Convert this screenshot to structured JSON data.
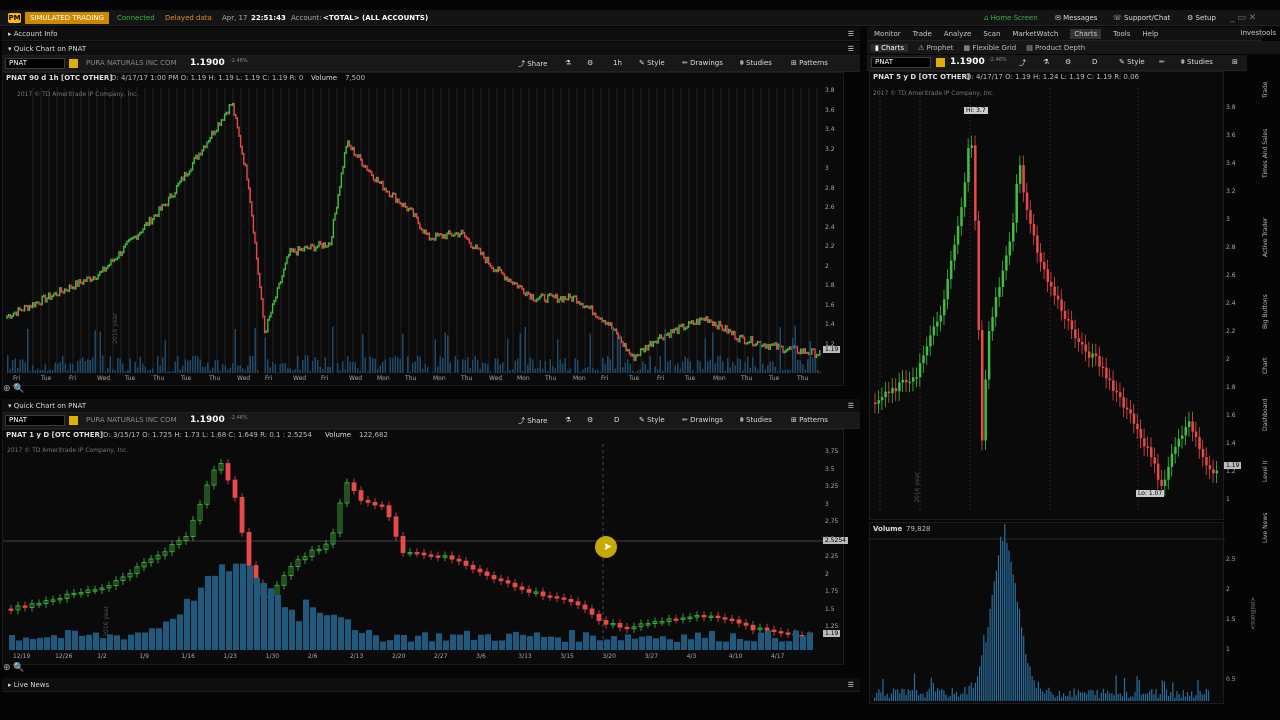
{
  "top": {
    "pm": "PM",
    "mode": "SIMULATED TRADING",
    "connected": "Connected",
    "delayed": "Delayed data",
    "date": "Apr, 17",
    "time": "22:51:43",
    "account": "Account:",
    "account_val": "<TOTAL> (ALL ACCOUNTS)",
    "home": "Home Screen",
    "messages": "Messages",
    "support": "Support/Chat",
    "setup": "Setup"
  },
  "left": {
    "account_info": "Account Info",
    "q1": {
      "title": "Quick Chart on PNAT",
      "symbol": "PNAT",
      "company": "PURA NATURALS INC COM",
      "price": "1.1900",
      "chg": "-2.46%",
      "period": "1h",
      "style": "Style",
      "drawings": "Drawings",
      "studies": "Studies",
      "patterns": "Patterns",
      "share": "Share",
      "info": "PNAT 90 d 1h [OTC OTHER]",
      "ohlc": "D: 4/17/17 1:00 PM   O: 1.19   H: 1.19   L: 1.19   C: 1.19   R: 0",
      "volume": "Volume",
      "vol_val": "7,500",
      "copyright": "2017 © TD Ameritrade IP Company, Inc.",
      "last": "1.19",
      "xlabels": [
        "Fri",
        "Tue",
        "Fri",
        "Wed",
        "Tue",
        "Thu",
        "Tue",
        "Thu",
        "Wed",
        "Fri",
        "Wed",
        "Fri",
        "Wed",
        "Mon",
        "Thu",
        "Mon",
        "Thu",
        "Wed",
        "Mon",
        "Thu",
        "Mon",
        "Fri",
        "Tue",
        "Fri",
        "Tue",
        "Mon",
        "Thu",
        "Tue",
        "Thu"
      ],
      "ylabels": [
        "3.8",
        "3.6",
        "3.4",
        "3.2",
        "3",
        "2.8",
        "2.6",
        "2.4",
        "2.2",
        "2",
        "1.8",
        "1.6",
        "1.4",
        "1.2"
      ],
      "year": "2016 year"
    },
    "q2": {
      "title": "Quick Chart on PNAT",
      "symbol": "PNAT",
      "company": "PURA NATURALS INC COM",
      "price": "1.1900",
      "chg": "-2.46%",
      "period": "D",
      "style": "Style",
      "drawings": "Drawings",
      "studies": "Studies",
      "patterns": "Patterns",
      "share": "Share",
      "info": "PNAT 1 y D [OTC OTHER]",
      "ohlc": "D: 3/15/17   O: 1.725   H: 1.73   L: 1.68   C: 1.649   R: 0.1   : 2.5254",
      "volume": "Volume",
      "vol_val": "122,682",
      "copyright": "2017 © TD Ameritrade IP Company, Inc.",
      "last": "1.19",
      "cross": "2.5254",
      "xlabels": [
        "12/19",
        "12/26",
        "1/2",
        "1/9",
        "1/16",
        "1/23",
        "1/30",
        "2/6",
        "2/13",
        "2/20",
        "2/27",
        "3/6",
        "3/13",
        "3/15",
        "3/20",
        "3/27",
        "4/3",
        "4/10",
        "4/17"
      ],
      "ylabels": [
        "3.75",
        "3.5",
        "3.25",
        "3",
        "2.75",
        "2.5",
        "2.25",
        "2",
        "1.75",
        "1.5",
        "1.25"
      ],
      "year": "2016 year"
    },
    "live_news": "Live News"
  },
  "right": {
    "menu": [
      "Monitor",
      "Trade",
      "Analyze",
      "Scan",
      "MarketWatch",
      "Charts",
      "Tools",
      "Help"
    ],
    "investools": "Investools",
    "subtabs": [
      "Charts",
      "Prophet",
      "Flexible Grid",
      "Product Depth"
    ],
    "symbol": "PNAT",
    "price": "1.1900",
    "chg": "-2.46%",
    "period": "D",
    "style": "Style",
    "studies": "Studies",
    "info": "PNAT 5 y D [OTC OTHER]",
    "ohlc": "D: 4/17/17   O: 1.19   H: 1.24   L: 1.19   C: 1.19   R: 0.06",
    "copyright": "2017 © TD Ameritrade IP Company, Inc.",
    "hi": "Hi: 3.7",
    "lo": "Lo: 1.07",
    "last": "1.19",
    "ylabels": [
      "3.8",
      "3.6",
      "3.4",
      "3.2",
      "3",
      "2.8",
      "2.6",
      "2.4",
      "2.2",
      "2",
      "1.8",
      "1.6",
      "1.4",
      "1.2",
      "1"
    ],
    "volume": "Volume",
    "vol_val": "79,828",
    "vol_y": [
      "2.5",
      "2",
      "1.5",
      "1",
      "0.5"
    ],
    "millions": "<millions>",
    "year": "2016 year",
    "side_tabs": [
      "Trade",
      "Times And Sales",
      "Active Trader",
      "Big Buttons",
      "Chart",
      "Dashboard",
      "Level II",
      "Live News"
    ]
  }
}
